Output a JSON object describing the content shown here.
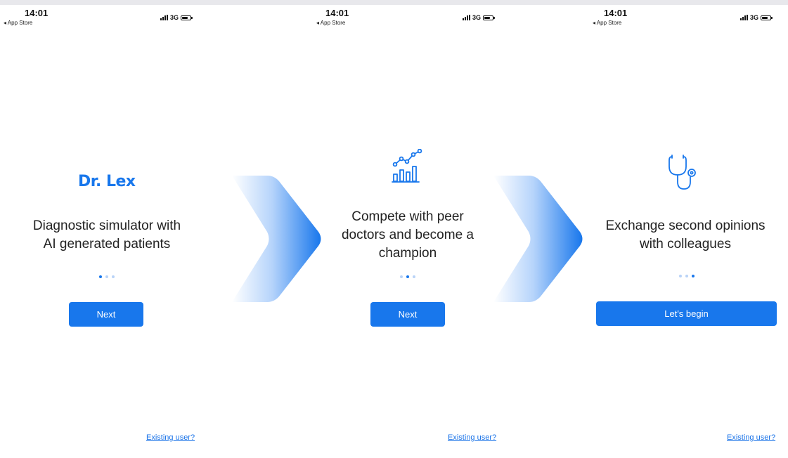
{
  "status_bar": {
    "time": "14:01",
    "back_label": "◂ App Store",
    "network": "3G"
  },
  "screens": [
    {
      "logo": "Dr. Lex",
      "headline_lines": [
        "Diagnostic simulator with",
        "AI generated patients"
      ],
      "page_indicator": {
        "total": 3,
        "active": 1
      },
      "button_label": "Next",
      "existing_user_link": "Existing user?"
    },
    {
      "icon": "chart-growth-icon",
      "headline_lines": [
        "Compete with peer",
        "doctors and become a",
        "champion"
      ],
      "page_indicator": {
        "total": 3,
        "active": 2
      },
      "button_label": "Next",
      "existing_user_link": "Existing user?"
    },
    {
      "icon": "stethoscope-icon",
      "headline_lines": [
        "Exchange second opinions",
        "with colleagues"
      ],
      "page_indicator": {
        "total": 3,
        "active": 3
      },
      "button_label": "Let's begin",
      "existing_user_link": "Existing user?"
    }
  ],
  "colors": {
    "accent": "#1877ec",
    "link": "#1a73e8",
    "dot_inactive": "#b9d3f7",
    "text": "#222222"
  }
}
